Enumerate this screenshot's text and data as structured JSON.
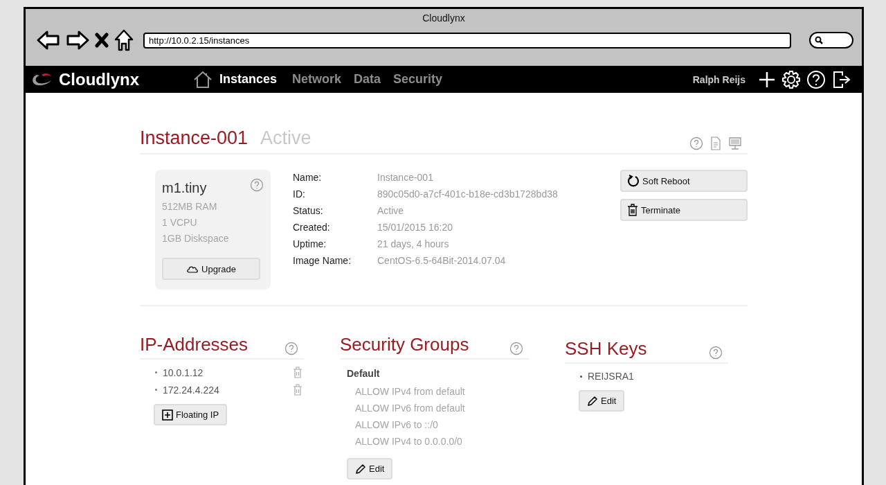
{
  "window": {
    "title": "Cloudlynx"
  },
  "browser": {
    "url": "http://10.0.2.15/instances"
  },
  "navbar": {
    "brand": "Cloudlynx",
    "user": "Ralph Reijs",
    "items": [
      {
        "label": "Instances",
        "selected": true,
        "home": true
      },
      {
        "label": "Network",
        "selected": false,
        "home": false
      },
      {
        "label": "Data",
        "selected": false,
        "home": false
      },
      {
        "label": "Security",
        "selected": false,
        "home": false
      }
    ]
  },
  "instance": {
    "name": "Instance-001",
    "status": "Active",
    "flavor": {
      "name": "m1.tiny",
      "specs": [
        "512MB RAM",
        "1 VCPU",
        "1GB Diskspace"
      ],
      "button": "Upgrade"
    },
    "details": [
      {
        "label": "Name:",
        "value": "Instance-001"
      },
      {
        "label": "ID:",
        "value": "890c05d0-a7cf-401c-b18e-cd3b1728bd38"
      },
      {
        "label": "Status:",
        "value": "Active"
      },
      {
        "label": "Created:",
        "value": "15/01/2015 16:20"
      },
      {
        "label": "Uptime:",
        "value": "21 days, 4 hours"
      },
      {
        "label": "Image Name:",
        "value": "CentOS-6.5-64Bit-2014.07.04"
      }
    ],
    "actions": [
      {
        "label": "Soft Reboot",
        "kind": "reboot"
      },
      {
        "label": "Terminate",
        "kind": "delete"
      }
    ]
  },
  "ip_addresses": {
    "title": "IP-Addresses",
    "items": [
      "10.0.1.12",
      "172.24.4.224"
    ],
    "button": "Floating IP"
  },
  "security_groups": {
    "title": "Security Groups",
    "group": "Default",
    "rules": [
      "ALLOW IPv4 from default",
      "ALLOW IPv6 from default",
      "ALLOW IPv6 to ::/0",
      "ALLOW IPv4 to 0.0.0.0/0"
    ],
    "button": "Edit"
  },
  "ssh_keys": {
    "title": "SSH Keys",
    "items": [
      "REIJSRA1"
    ],
    "button": "Edit"
  }
}
